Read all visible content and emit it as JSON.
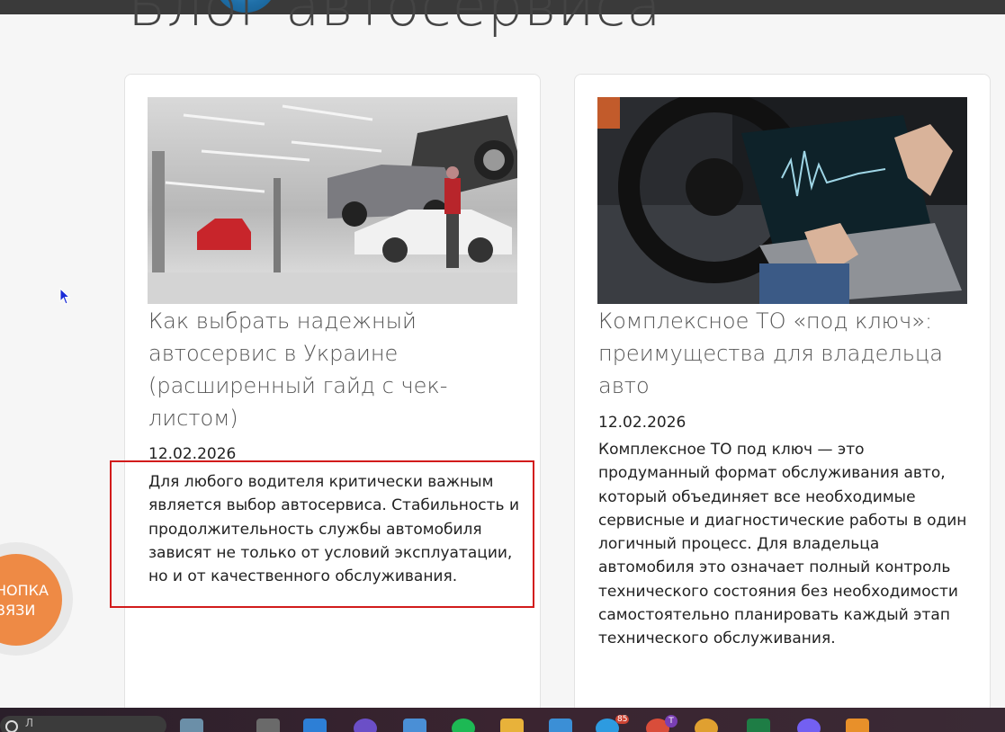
{
  "page": {
    "title": "Блог автосервиса"
  },
  "posts": [
    {
      "title": "Как выбрать надежный автосервис в Украине (расширенный гайд с чек-листом)",
      "date": "12.02.2026",
      "excerpt": "Для любого водителя критически важным является выбор автосервиса. Стабильность и продолжительность службы автомобиля зависят не только от условий эксплуатации, но и от качественного обслуживания.",
      "image": "car-service-garage-photo"
    },
    {
      "title": "Комплексное ТО «под ключ»: преимущества для владельца авто",
      "date": "12.02.2026",
      "excerpt": "Комплексное ТО под ключ — это продуманный формат обслуживания авто, который объединяет все необходимые сервисные и диагностические работы в один логичный процесс. Для владельца автомобиля это означает полный контроль технического состояния без необходимости самостоятельно планировать каждый этап технического обслуживания.",
      "image": "car-diagnostics-laptop-photo"
    }
  ],
  "callback_button": {
    "label_line1": "НОПКА",
    "label_line2": "ВЯЗИ"
  },
  "taskbar": {
    "search_placeholder": "Л",
    "badge_count": "85",
    "profile_badge": "T"
  },
  "colors": {
    "highlight": "#d21b1b",
    "callback": "#ee8a45",
    "taskbar": "#2a1f2a"
  }
}
